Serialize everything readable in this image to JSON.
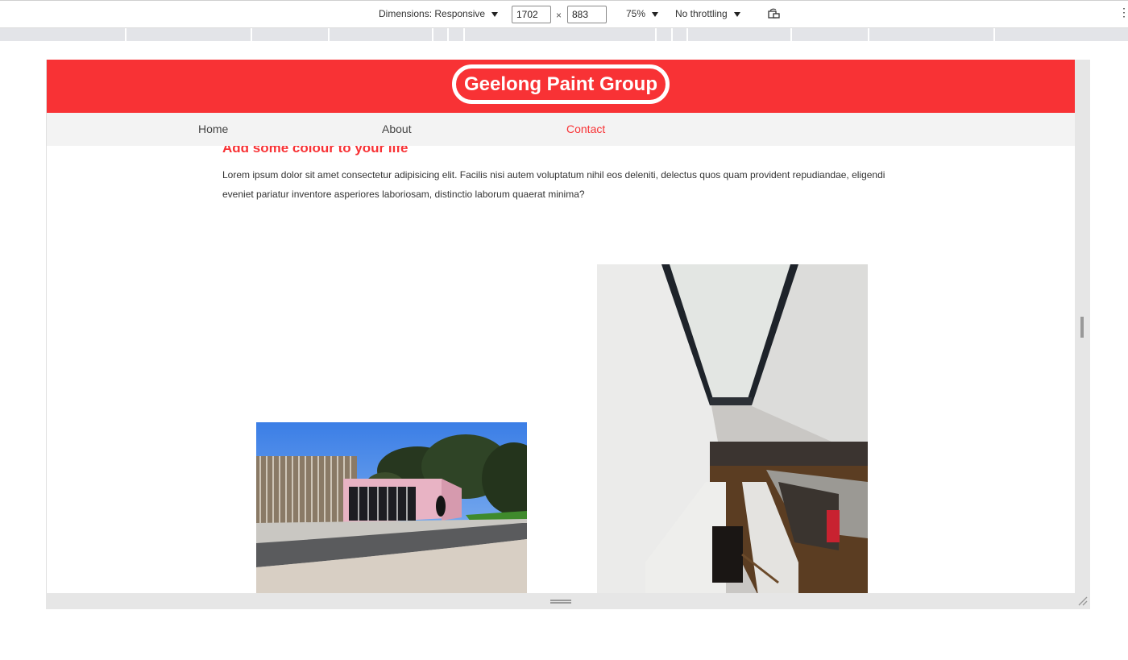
{
  "devtools": {
    "dimensions_label": "Dimensions: Responsive",
    "width": "1702",
    "height": "883",
    "times": "×",
    "zoom": "75%",
    "throttling": "No throttling",
    "more": "⋮"
  },
  "site": {
    "logo": "Geelong Paint Group",
    "nav": [
      {
        "label": "Home"
      },
      {
        "label": "About"
      },
      {
        "label": "Contact"
      }
    ],
    "active_nav": "Contact",
    "heading": "Add some colour to your life",
    "paragraph": "Lorem ipsum dolor sit amet consectetur adipisicing elit. Facilis nisi autem voluptatum nihil eos deleniti, delectus quos quam provident repudiandae, eligendi eveniet pariatur inventore asperiores laboriosam, distinctio laborum quaerat minima?"
  },
  "colors": {
    "brand_red": "#f83235",
    "nav_bg": "#f3f3f3"
  },
  "icons": [
    "caret-down-icon",
    "rotate-icon",
    "more-options-icon",
    "resize-handle-icon"
  ]
}
